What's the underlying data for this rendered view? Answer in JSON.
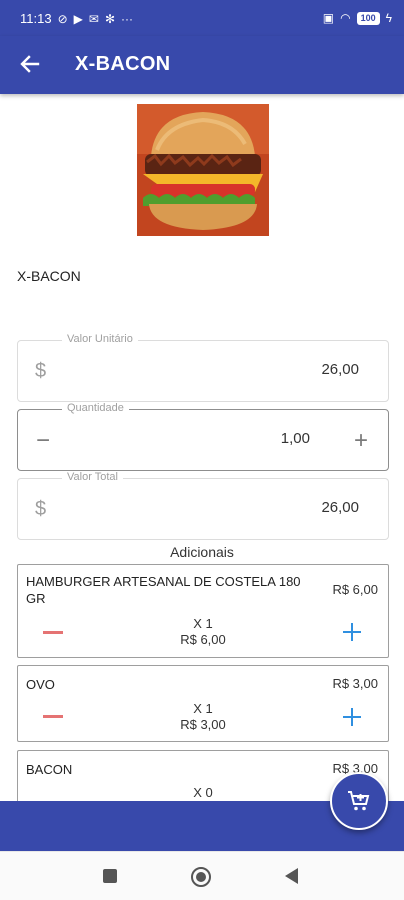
{
  "status_bar": {
    "time": "11:13",
    "battery": "100"
  },
  "app_bar": {
    "title": "X-BACON",
    "back_icon": "arrow-left-icon"
  },
  "product": {
    "image_icon": "burger-image",
    "name": "X-BACON"
  },
  "fields": {
    "unit_value": {
      "label": "Valor Unitário",
      "prefix": "$",
      "value": "26,00"
    },
    "quantity": {
      "label": "Quantidade",
      "value": "1,00",
      "minus": "−",
      "plus": "+"
    },
    "total_value": {
      "label": "Valor Total",
      "prefix": "$",
      "value": "26,00"
    }
  },
  "addons_title": "Adicionais",
  "addons": [
    {
      "name": "HAMBURGER ARTESANAL DE COSTELA 180 GR",
      "price": "R$ 6,00",
      "qty": "X 1",
      "subtotal": "R$ 6,00"
    },
    {
      "name": "OVO",
      "price": "R$ 3,00",
      "qty": "X 1",
      "subtotal": "R$ 3,00"
    },
    {
      "name": "BACON",
      "price": "R$ 3,00",
      "qty": "X 0",
      "subtotal": ""
    }
  ],
  "fab_icon": "add-shopping-cart-icon",
  "colors": {
    "primary": "#3849ab",
    "minus": "#e57373",
    "plus": "#2f8fe0"
  }
}
